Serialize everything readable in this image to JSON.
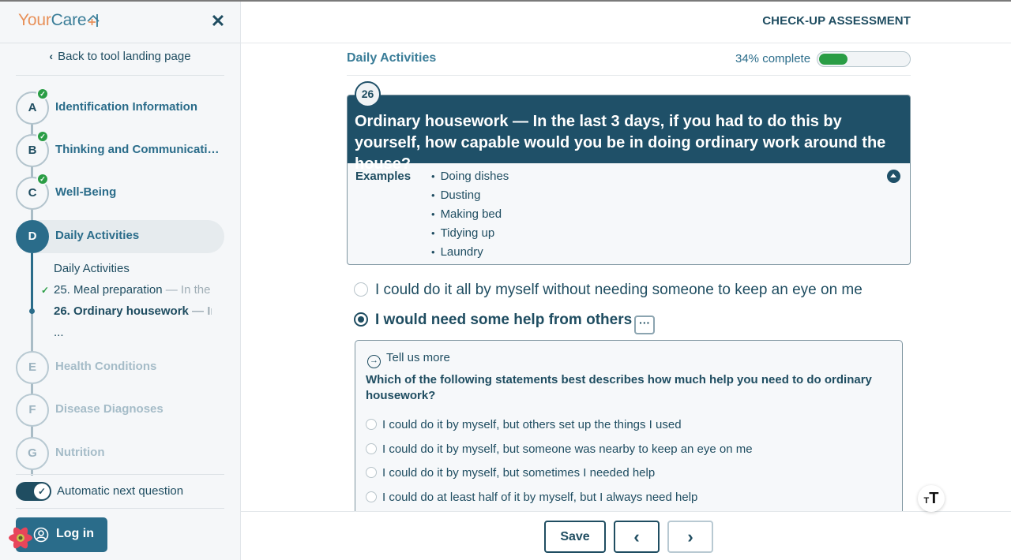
{
  "app": {
    "logo_part1": "Your",
    "logo_part2": "Care",
    "header_title": "CHECK-UP ASSESSMENT"
  },
  "sidebar": {
    "back_label": "Back to tool landing page",
    "sections": [
      {
        "letter": "A",
        "label": "Identification Information",
        "status": "complete"
      },
      {
        "letter": "B",
        "label": "Thinking and Communicati…",
        "status": "complete"
      },
      {
        "letter": "C",
        "label": "Well-Being",
        "status": "complete"
      },
      {
        "letter": "D",
        "label": "Daily Activities",
        "status": "active"
      },
      {
        "letter": "E",
        "label": "Health Conditions",
        "status": "upcoming"
      },
      {
        "letter": "F",
        "label": "Disease Diagnoses",
        "status": "upcoming"
      },
      {
        "letter": "G",
        "label": "Nutrition",
        "status": "upcoming"
      }
    ],
    "subitems": {
      "heading": "Daily Activities",
      "item25_main": "25. Meal preparation",
      "item25_rest": " — In the",
      "item26_main": "26. Ordinary housework",
      "item26_rest": " — In t",
      "ellipsis": "..."
    },
    "toggle_label": "Automatic next question",
    "toggle_on": true,
    "login_label": "Log in"
  },
  "main": {
    "section_title": "Daily Activities",
    "progress_text": "34% complete",
    "progress_percent": 34,
    "question": {
      "number": "26",
      "text": "Ordinary housework — In the last 3 days, if you had to do this by yourself, how capable would you be in doing ordinary work around the house?",
      "examples_label": "Examples",
      "examples": [
        "Doing dishes",
        "Dusting",
        "Making bed",
        "Tidying up",
        "Laundry"
      ]
    },
    "options": [
      {
        "label": "I could do it all by myself without needing someone to keep an eye on me",
        "selected": false
      },
      {
        "label": "I would need some help from others",
        "selected": true
      }
    ],
    "more_label": "···",
    "followup": {
      "title": "Tell us more",
      "question": "Which of the following statements best describes how much help you need to do ordinary housework?",
      "options": [
        "I could do it by myself, but others set up the things I used",
        "I could do it by myself, but someone was nearby to keep an eye on me",
        "I could do it by myself, but sometimes I needed help",
        "I could do at least half of it by myself, but I always need help"
      ]
    }
  },
  "footer": {
    "save_label": "Save",
    "prev_icon": "‹",
    "next_icon": "›"
  },
  "colors": {
    "brand_dark": "#1f4d61",
    "brand": "#2a6c8a",
    "brand_orange": "#e8915a",
    "success": "#2a9d45"
  }
}
